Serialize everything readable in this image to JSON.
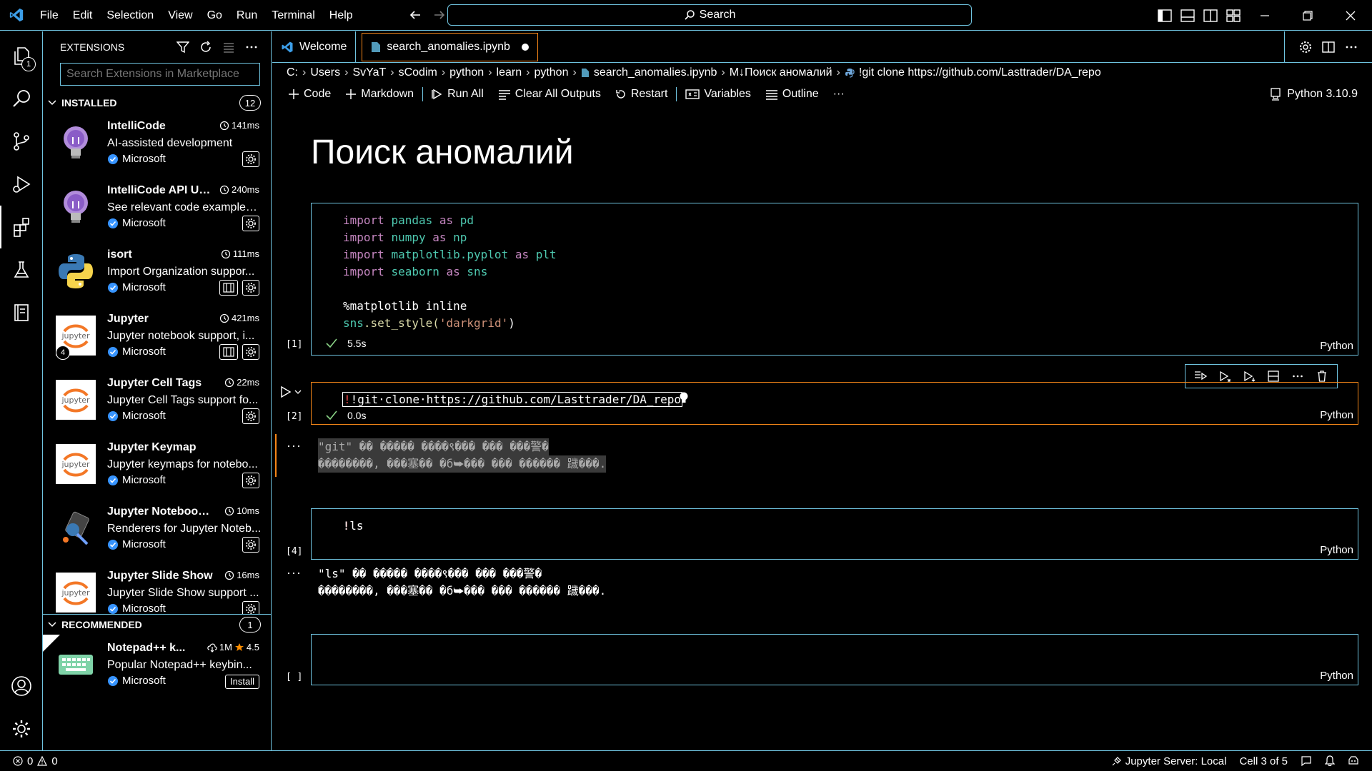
{
  "menu": [
    "File",
    "Edit",
    "Selection",
    "View",
    "Go",
    "Run",
    "Terminal",
    "Help"
  ],
  "command_center": {
    "label": "Search"
  },
  "activity": {
    "explorer_badge": "1"
  },
  "sidebar": {
    "title": "EXTENSIONS",
    "search_placeholder": "Search Extensions in Marketplace",
    "installed": {
      "label": "INSTALLED",
      "count": "12"
    },
    "recommended": {
      "label": "RECOMMENDED",
      "count": "1"
    },
    "extensions": [
      {
        "name": "IntelliCode",
        "time": "141ms",
        "desc": "AI-assisted development",
        "publisher": "Microsoft"
      },
      {
        "name": "IntelliCode API Us...",
        "time": "240ms",
        "desc": "See relevant code examples ...",
        "publisher": "Microsoft"
      },
      {
        "name": "isort",
        "time": "111ms",
        "desc": "Import Organization suppor...",
        "publisher": "Microsoft"
      },
      {
        "name": "Jupyter",
        "time": "421ms",
        "desc": "Jupyter notebook support, i...",
        "publisher": "Microsoft",
        "badge": "4"
      },
      {
        "name": "Jupyter Cell Tags",
        "time": "22ms",
        "desc": "Jupyter Cell Tags support fo...",
        "publisher": "Microsoft"
      },
      {
        "name": "Jupyter Keymap",
        "time": "",
        "desc": "Jupyter keymaps for notebo...",
        "publisher": "Microsoft"
      },
      {
        "name": "Jupyter Notebook ...",
        "time": "10ms",
        "desc": "Renderers for Jupyter Noteb...",
        "publisher": "Microsoft"
      },
      {
        "name": "Jupyter Slide Show",
        "time": "16ms",
        "desc": "Jupyter Slide Show support ...",
        "publisher": "Microsoft"
      }
    ],
    "recommended_ext": {
      "name": "Notepad++ k...",
      "downloads": "1M",
      "rating": "4.5",
      "desc": "Popular Notepad++ keybin...",
      "publisher": "Microsoft",
      "install": "Install"
    },
    "jupyter_icon_text": "jupyter"
  },
  "tabs": [
    {
      "label": "Welcome"
    },
    {
      "label": "search_anomalies.ipynb"
    }
  ],
  "breadcrumb": [
    "C:",
    "Users",
    "SvYaT",
    "sCodim",
    "python",
    "learn",
    "python",
    "search_anomalies.ipynb",
    "M↓Поиск аномалий",
    "!git clone https://github.com/Lasttrader/DA_repo"
  ],
  "toolbar": {
    "code": "Code",
    "markdown": "Markdown",
    "run_all": "Run All",
    "clear_outputs": "Clear All Outputs",
    "restart": "Restart",
    "variables": "Variables",
    "outline": "Outline",
    "more": "···",
    "kernel": "Python 3.10.9"
  },
  "notebook": {
    "heading": "Поиск аномалий",
    "cells": [
      {
        "exec": "[1]",
        "lang": "Python",
        "time": "5.5s",
        "lines": [
          [
            "import",
            "pandas",
            "as",
            "pd"
          ],
          [
            "import",
            "numpy",
            "as",
            "np"
          ],
          [
            "import",
            "matplotlib",
            ".pyplot",
            "as",
            "plt"
          ],
          [
            "import",
            "seaborn",
            "as",
            "sns"
          ]
        ],
        "magic": "%matplotlib inline",
        "call_obj": "sns",
        "call_fn": ".set_style(",
        "call_arg": "'darkgrid'",
        "call_end": ")"
      },
      {
        "exec": "[2]",
        "lang": "Python",
        "time": "0.0s",
        "code": "!git·clone·https://github.com/Lasttrader/DA_repo",
        "output_1": "\"git\" �� ����� ����९��� ��� ���警�",
        "output_2": "��������, ���塞�� �б⮩��� ��� ������ 䠩���."
      },
      {
        "exec": "[4]",
        "lang": "Python",
        "code": "!ls",
        "output_1": "\"ls\" �� ����� ����९��� ��� ���警�",
        "output_2": "��������, ���塞�� �б⮩��� ��� ������ 䠩���."
      },
      {
        "exec": "[ ]",
        "lang": "Python"
      }
    ],
    "out_dots": "···"
  },
  "statusbar": {
    "errors": "0",
    "warnings": "0",
    "jupyter_server": "Jupyter Server: Local",
    "cell_pos": "Cell 3 of 5"
  }
}
